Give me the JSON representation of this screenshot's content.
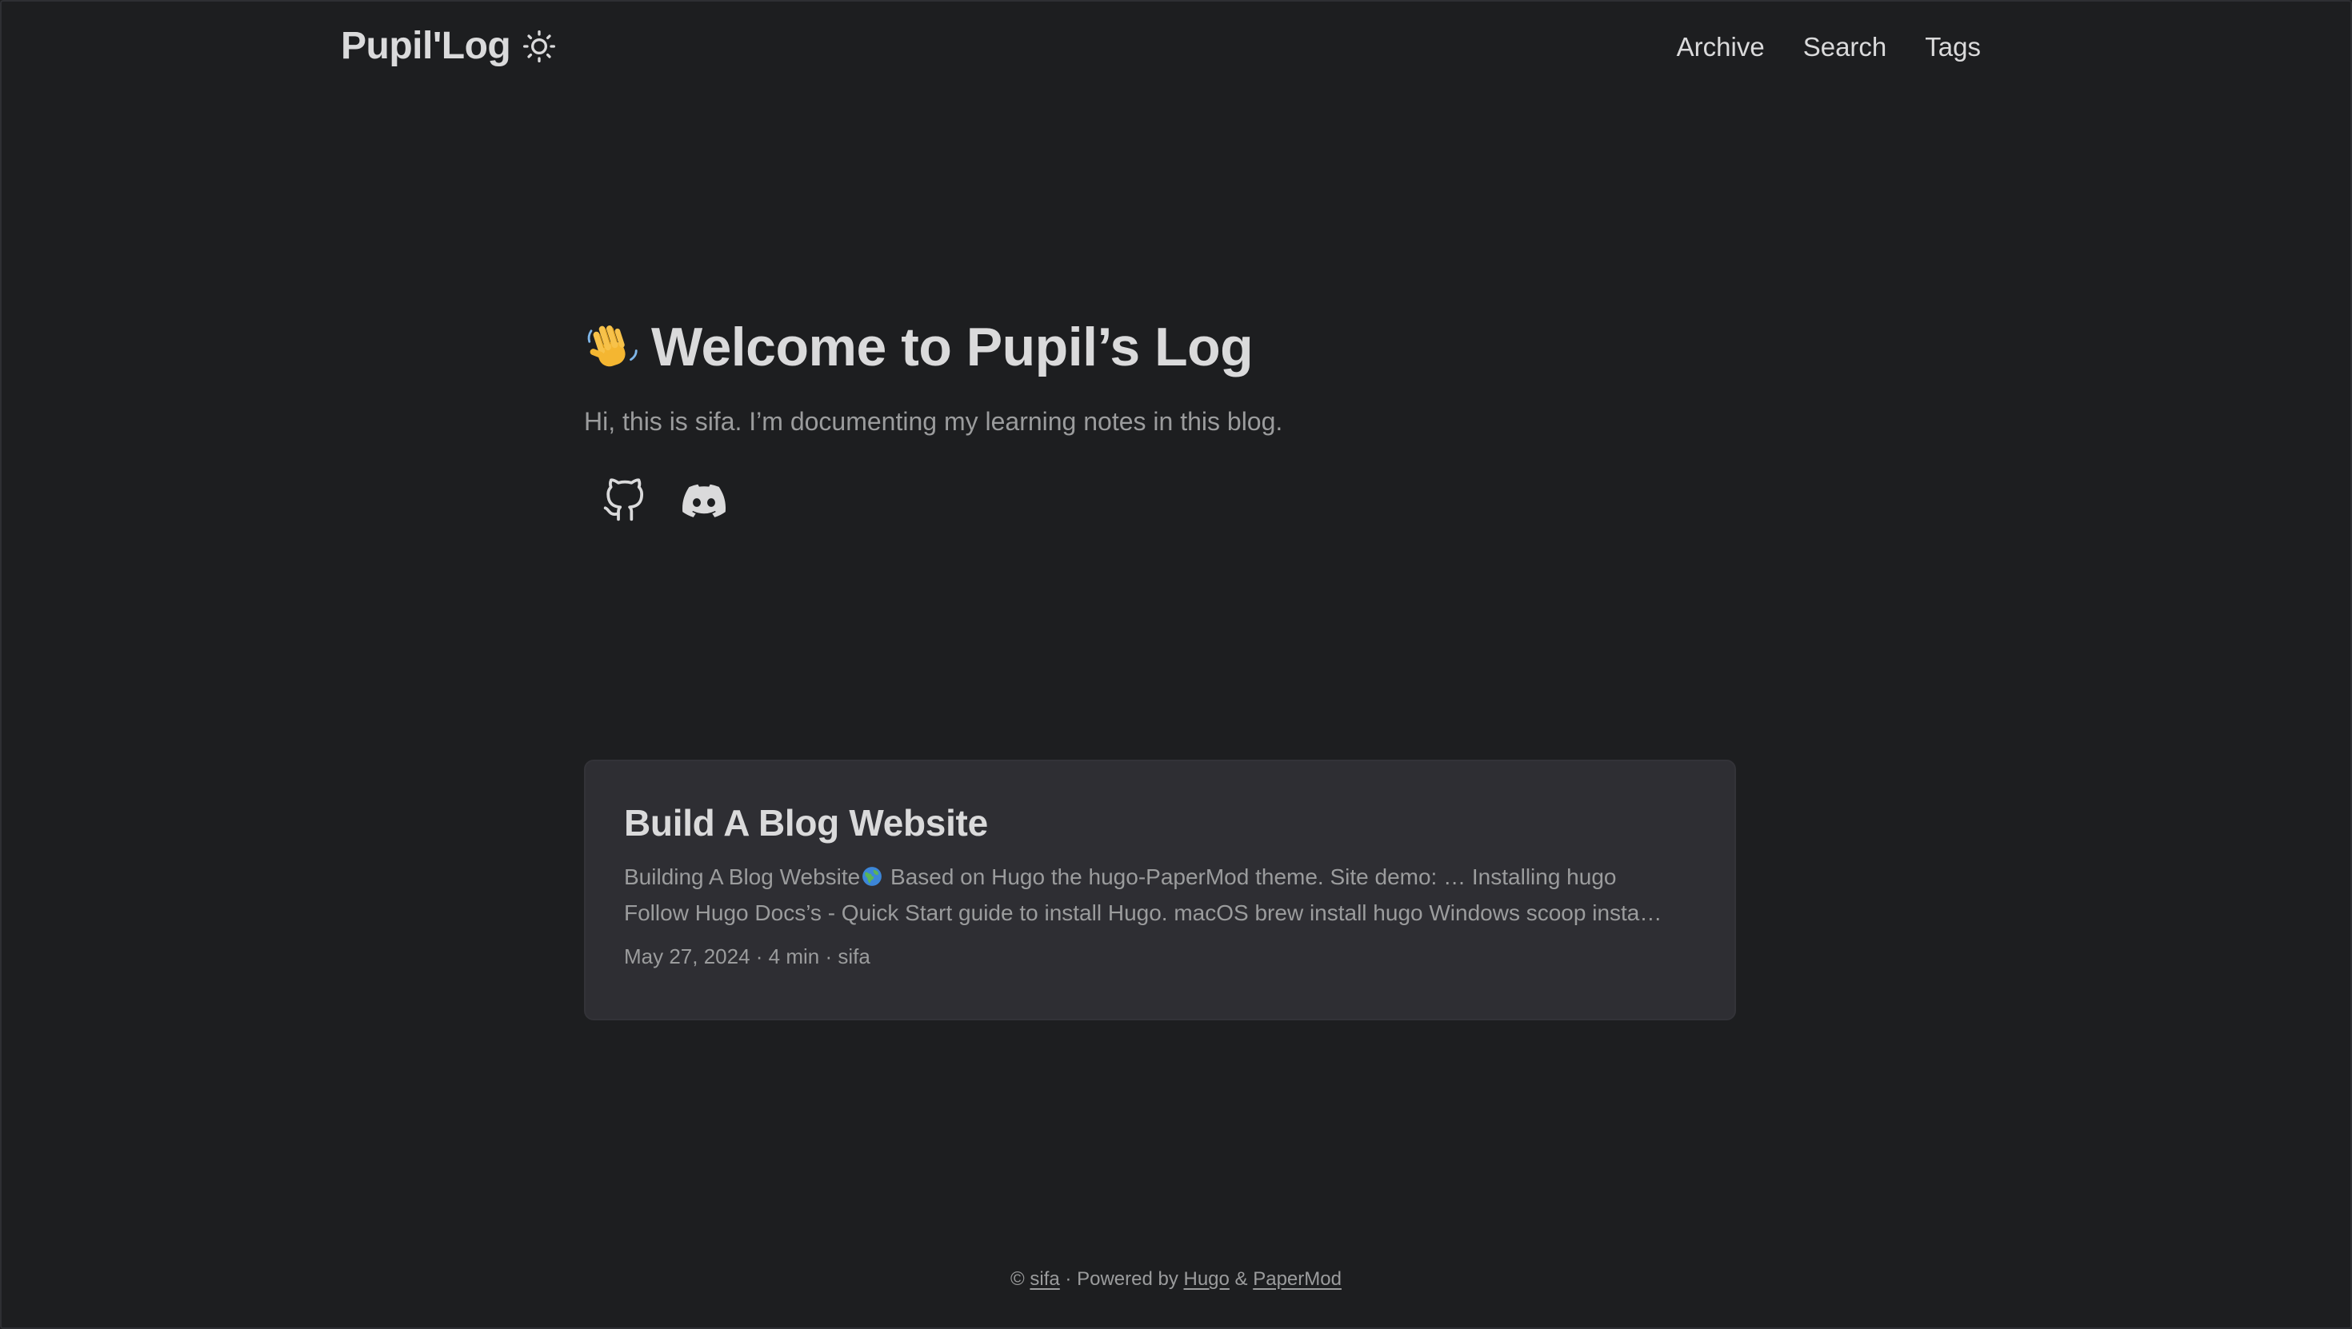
{
  "header": {
    "logo": "Pupil'Log",
    "theme_toggle_icon": "sun-icon",
    "nav": [
      "Archive",
      "Search",
      "Tags"
    ]
  },
  "hero": {
    "title_emoji_icon": "waving-hand-icon",
    "title": "Welcome to Pupil’s Log",
    "subtitle": "Hi, this is sifa. I’m documenting my learning notes in this blog.",
    "socials": [
      "github-icon",
      "discord-icon"
    ]
  },
  "posts": [
    {
      "title": "Build A Blog Website",
      "summary_line1_before": "Building A Blog Website",
      "summary_icon": "globe-icon",
      "summary_line1_after": " Based on Hugo the hugo-PaperMod theme. Site demo: … Installing hugo",
      "summary_line2": "Follow Hugo Docs’s - Quick Start guide to install Hugo. macOS brew install hugo Windows scoop insta…",
      "meta": "May 27, 2024 · 4 min · sifa"
    }
  ],
  "footer": {
    "copyright_prefix": "© ",
    "author_link": "sifa",
    "powered_by": " · Powered by ",
    "hugo_link": "Hugo",
    "amp": " & ",
    "theme_link": "PaperMod"
  },
  "colors": {
    "background": "#1d1e20",
    "card": "#2e2e33",
    "primary_text": "#dadadb",
    "secondary_text": "#9b9c9d"
  }
}
